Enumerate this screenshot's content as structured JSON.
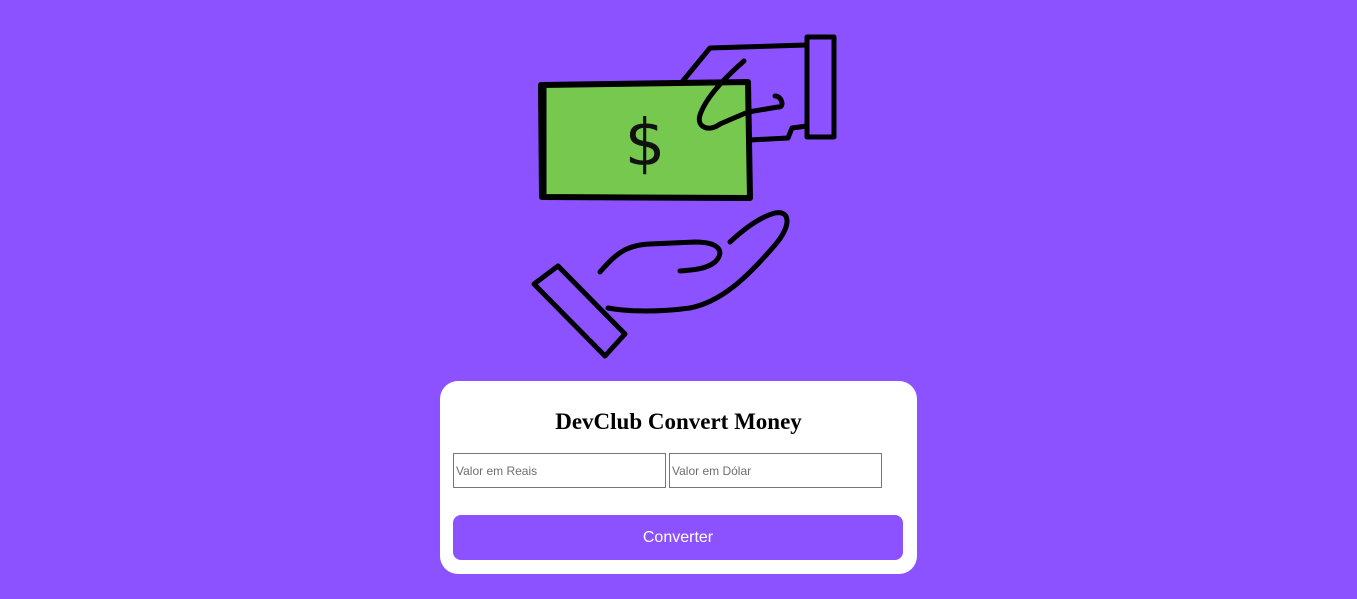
{
  "colors": {
    "background": "#8c52ff",
    "card": "#ffffff",
    "button": "#8c52ff",
    "banknote": "#76c84f"
  },
  "illustration": {
    "icon": "money-exchange-hands",
    "note_symbol": "$"
  },
  "converter": {
    "title": "DevClub Convert Money",
    "reais_placeholder": "Valor em Reais",
    "dolar_placeholder": "Valor em Dólar",
    "button_label": "Converter"
  }
}
